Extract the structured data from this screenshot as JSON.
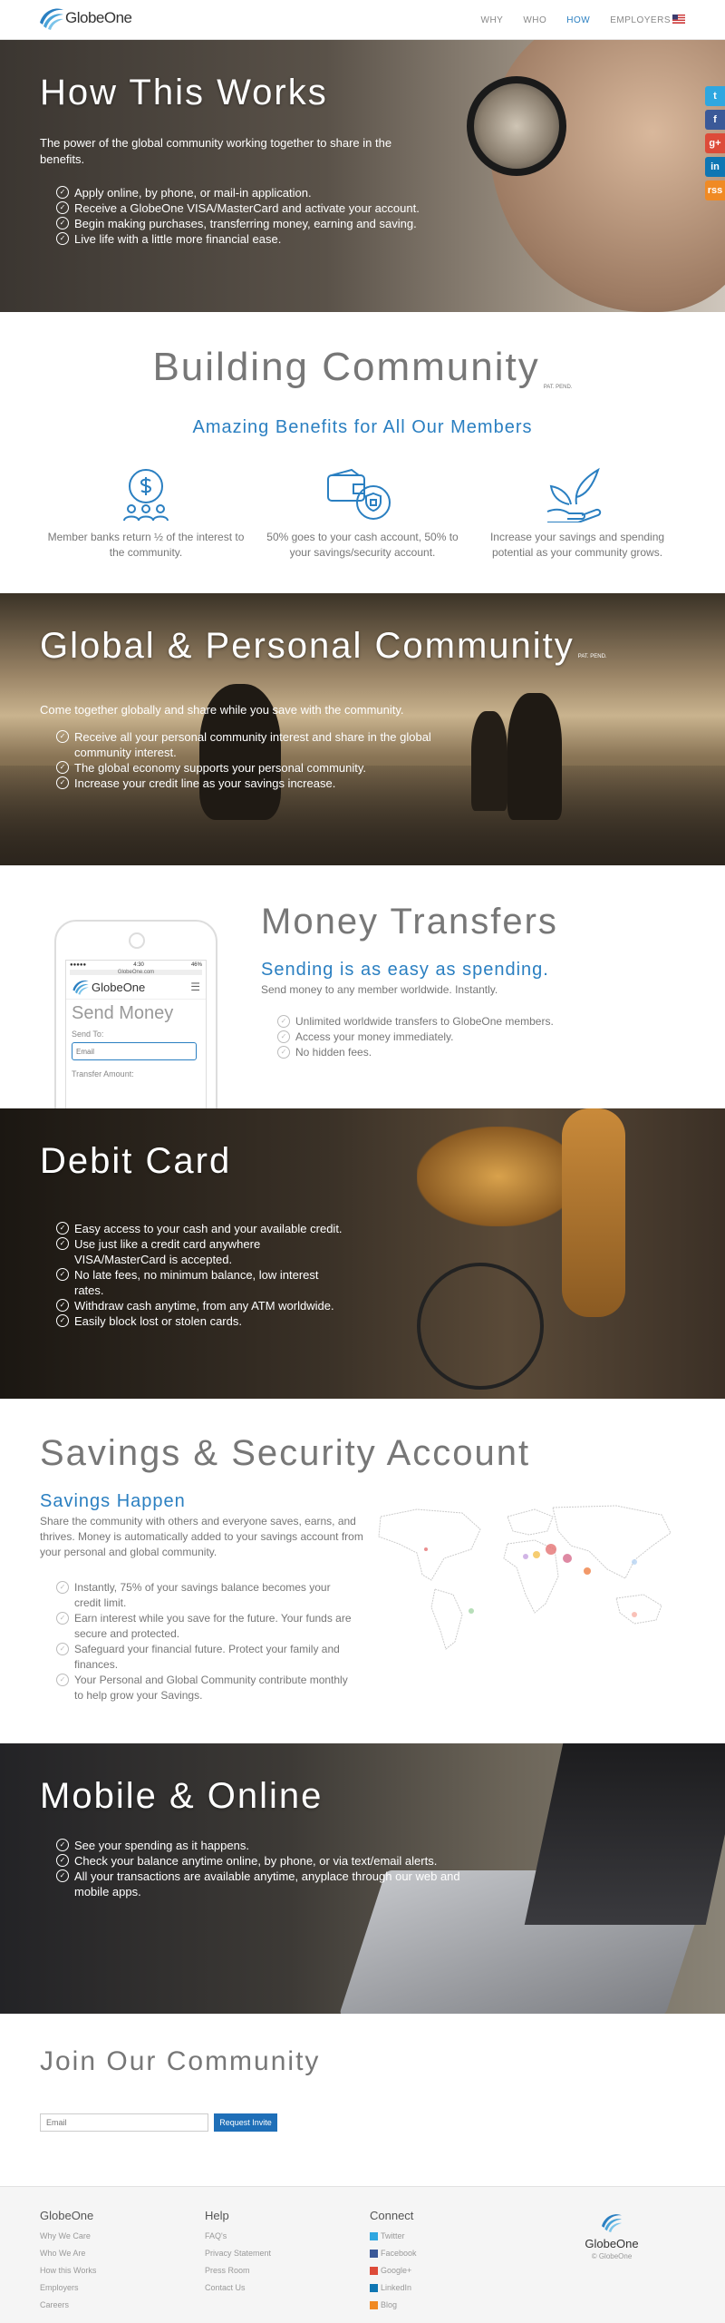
{
  "nav": {
    "logo": "GlobeOne",
    "links": [
      "WHY",
      "WHO",
      "HOW",
      "EMPLOYERS"
    ],
    "active": "HOW"
  },
  "social": [
    "t",
    "f",
    "g+",
    "in",
    "rss"
  ],
  "hero": {
    "title": "How This Works",
    "lead": "The power of the global community working together to share in the benefits.",
    "items": [
      "Apply online, by phone, or mail-in application.",
      "Receive a GlobeOne VISA/MasterCard and activate your account.",
      "Begin making purchases, transferring money, earning and saving.",
      "Live life with a little more financial ease."
    ]
  },
  "community": {
    "title": "Building Community",
    "pat": "PAT. PEND.",
    "subtitle": "Amazing Benefits for All Our Members",
    "benefits": [
      "Member banks return ½ of the interest to the community.",
      "50% goes to your cash account, 50% to your savings/security account.",
      "Increase your savings and spending potential as your community grows."
    ]
  },
  "global": {
    "title": "Global & Personal Community",
    "pat": "PAT. PEND.",
    "lead": "Come together globally and share while you save with the community.",
    "items": [
      "Receive all your personal community interest and share in the global community interest.",
      "The global economy supports your personal community.",
      "Increase your credit line as your savings increase."
    ]
  },
  "transfers": {
    "title": "Money Transfers",
    "subtitle": "Sending is as easy as spending.",
    "lead": "Send money to any member worldwide. Instantly.",
    "items": [
      "Unlimited worldwide transfers to GlobeOne members.",
      "Access your money immediately.",
      "No hidden fees."
    ],
    "phone": {
      "time": "4:30",
      "battery": "46%",
      "url": "GlobeOne.com",
      "logo": "GlobeOne",
      "screen_title": "Send Money",
      "send_to": "Send To:",
      "email_placeholder": "Email",
      "amount": "Transfer Amount:"
    }
  },
  "debit": {
    "title": "Debit Card",
    "items": [
      "Easy access to your cash and your available credit.",
      "Use just like a credit card anywhere VISA/MasterCard is accepted.",
      "No late fees, no minimum balance, low interest rates.",
      "Withdraw cash anytime, from any ATM worldwide.",
      "Easily block lost or stolen cards."
    ]
  },
  "savings": {
    "title": "Savings & Security Account",
    "subtitle": "Savings Happen",
    "lead": "Share the community with others and everyone saves, earns, and thrives. Money is automatically added to your savings account from your personal and global community.",
    "items": [
      "Instantly, 75% of your savings balance becomes your credit limit.",
      "Earn interest while you save for the future. Your funds are secure and protected.",
      "Safeguard your financial future. Protect your family and finances.",
      "Your Personal and Global Community contribute monthly to help grow your Savings."
    ]
  },
  "mobile": {
    "title": "Mobile & Online",
    "items": [
      "See your spending as it happens.",
      "Check your balance anytime online, by phone, or via text/email alerts.",
      "All your transactions are available anytime, anyplace through our web and mobile apps."
    ]
  },
  "join": {
    "title": "Join Our Community",
    "placeholder": "Email",
    "button": "Request Invite"
  },
  "footer": {
    "col1": {
      "title": "GlobeOne",
      "links": [
        "Why We Care",
        "Who We Are",
        "How this Works",
        "Employers",
        "Careers"
      ]
    },
    "col2": {
      "title": "Help",
      "links": [
        "FAQ's",
        "Privacy Statement",
        "Press Room",
        "Contact Us"
      ]
    },
    "col3": {
      "title": "Connect",
      "links": [
        "Twitter",
        "Facebook",
        "Google+",
        "LinkedIn",
        "Blog"
      ]
    },
    "logo": "GlobeOne",
    "copyright": "© GlobeOne"
  },
  "colors": {
    "accent": "#2a7fc1",
    "twitter": "#2fa7e0",
    "facebook": "#3b5998",
    "google": "#dd4b39",
    "linkedin": "#0f76b3",
    "rss": "#f08a24"
  }
}
